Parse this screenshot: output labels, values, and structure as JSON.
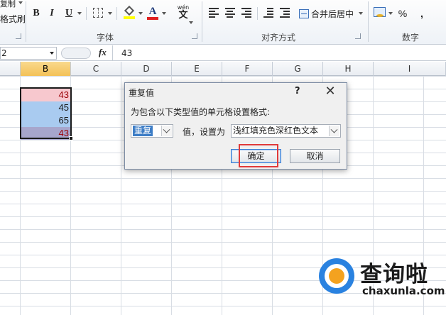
{
  "ribbon": {
    "clipboard_item1": "复制",
    "clipboard_item2": "格式刷",
    "font_group_label": "字体",
    "align_group_label": "对齐方式",
    "number_group_label": "数字",
    "bold": "B",
    "italic": "I",
    "underline": "U",
    "font_color_letter": "A",
    "wen": "wén",
    "wen_char": "文",
    "merge_label": "合并后居中",
    "percent": "%",
    "comma": ","
  },
  "formula_bar": {
    "name_box": "2",
    "fx_label": "fx",
    "value": "43"
  },
  "columns": [
    "B",
    "C",
    "D",
    "E",
    "F",
    "G",
    "H",
    "I"
  ],
  "cells": [
    {
      "value": "43",
      "bg": "#f7c8ce",
      "color": "#9c0006"
    },
    {
      "value": "45",
      "bg": "#a9cbf0",
      "color": "#1a1a1a"
    },
    {
      "value": "65",
      "bg": "#a9cbf0",
      "color": "#1a1a1a"
    },
    {
      "value": "43",
      "bg": "#a7a6cc",
      "color": "#9c0006"
    }
  ],
  "dialog": {
    "title": "重复值",
    "help": "?",
    "close": "✕",
    "prompt": "为包含以下类型值的单元格设置格式:",
    "type_value": "重复",
    "mid_label": "值，设置为",
    "format_value": "浅红填充色深红色文本",
    "ok_label": "确定",
    "cancel_label": "取消"
  },
  "watermark": {
    "title": "查询啦",
    "url": "chaxunla.com"
  },
  "colors": {
    "active_col": "#f3c157",
    "highlight": "#e03a3a",
    "dup_text": "#9c0006"
  }
}
